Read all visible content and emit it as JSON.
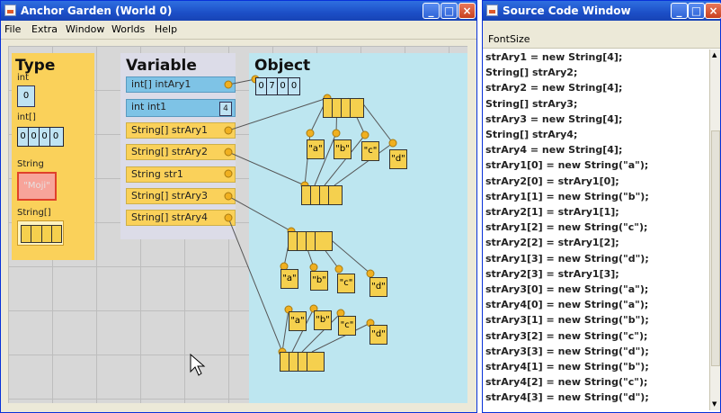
{
  "main_window": {
    "title": "Anchor Garden (World 0)",
    "menu": [
      "File",
      "Extra",
      "Window",
      "Worlds",
      "Help"
    ]
  },
  "type_panel": {
    "header": "Type",
    "int_label": "int",
    "int_value": "0",
    "int_array_label": "int[]",
    "int_array_cells": [
      "0",
      "0",
      "0",
      "0"
    ],
    "string_label": "String",
    "string_value": "\"Moji\"",
    "string_array_label": "String[]"
  },
  "variable_panel": {
    "header": "Variable",
    "variables": [
      {
        "label": "int[]  intAry1",
        "kind": "blue"
      },
      {
        "label": "int  int1",
        "kind": "blue",
        "value": "4"
      },
      {
        "label": "String[]  strAry1",
        "kind": "yellow"
      },
      {
        "label": "String[]  strAry2",
        "kind": "yellow"
      },
      {
        "label": "String  str1",
        "kind": "yellow"
      },
      {
        "label": "String[]  strAry3",
        "kind": "yellow"
      },
      {
        "label": "String[]  strAry4",
        "kind": "yellow"
      }
    ]
  },
  "object_panel": {
    "header": "Object",
    "int_array_cells": [
      "0",
      "7",
      "0",
      "0"
    ],
    "group1_strings": [
      "\"a\"",
      "\"b\"",
      "\"c\"",
      "\"d\""
    ],
    "group2_strings": [
      "\"a\"",
      "\"b\"",
      "\"c\"",
      "\"d\""
    ],
    "group3_strings": [
      "\"a\"",
      "\"b\"",
      "\"c\"",
      "\"d\""
    ]
  },
  "code_window": {
    "title": "Source Code Window",
    "menu": "FontSize",
    "lines": [
      "strAry1 = new String[4];",
      "String[] strAry2;",
      "strAry2 = new String[4];",
      "String[] strAry3;",
      "strAry3 = new String[4];",
      "String[] strAry4;",
      "strAry4 = new String[4];",
      "strAry1[0] = new String(\"a\");",
      "strAry2[0] = strAry1[0];",
      "strAry1[1] = new String(\"b\");",
      "strAry2[1] = strAry1[1];",
      "strAry1[2] = new String(\"c\");",
      "strAry2[2] = strAry1[2];",
      "strAry1[3] = new String(\"d\");",
      "strAry2[3] = strAry1[3];",
      "strAry3[0] = new String(\"a\");",
      "strAry4[0] = new String(\"a\");",
      "strAry3[1] = new String(\"b\");",
      "strAry3[2] = new String(\"c\");",
      "strAry3[3] = new String(\"d\");",
      "strAry4[1] = new String(\"b\");",
      "strAry4[2] = new String(\"c\");",
      "strAry4[3] = new String(\"d\");"
    ]
  }
}
